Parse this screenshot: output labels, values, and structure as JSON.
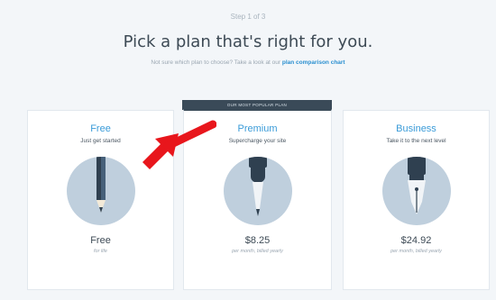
{
  "header": {
    "step": "Step 1 of 3",
    "title": "Pick a plan that's right for you.",
    "subtitle_text": "Not sure which plan to choose? Take a look at our",
    "subtitle_link": "plan comparison chart"
  },
  "banner": "OUR MOST POPULAR PLAN",
  "plans": [
    {
      "name": "Free",
      "tagline": "Just get started",
      "price": "Free",
      "price_note": "for life",
      "icon": "pencil-icon"
    },
    {
      "name": "Premium",
      "tagline": "Supercharge your site",
      "price": "$8.25",
      "price_note": "per month, billed yearly",
      "icon": "marker-icon"
    },
    {
      "name": "Business",
      "tagline": "Take it to the next level",
      "price": "$24.92",
      "price_note": "per month, billed yearly",
      "icon": "fountain-pen-icon"
    }
  ],
  "annotation": {
    "arrow_color": "#e8161c"
  }
}
